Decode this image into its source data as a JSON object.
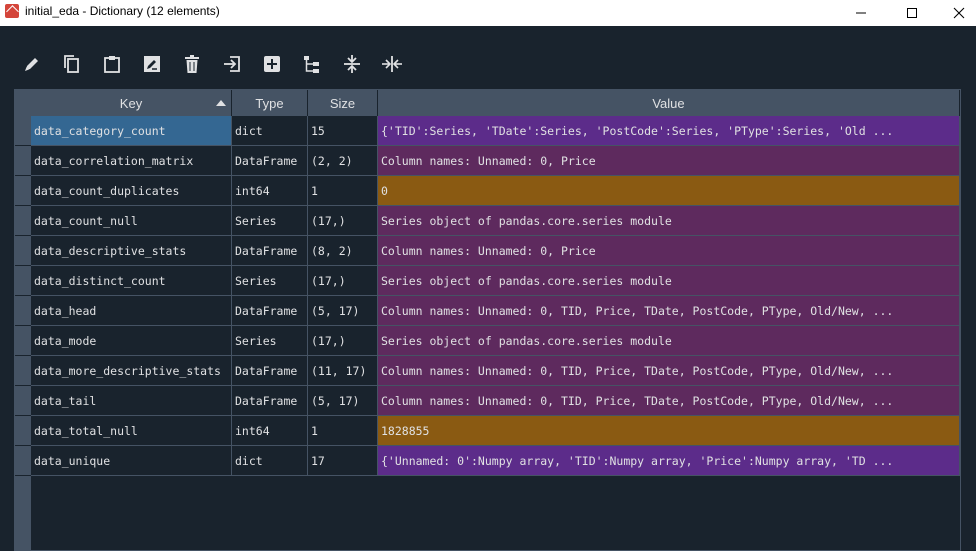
{
  "window": {
    "title": "initial_eda - Dictionary (12 elements)"
  },
  "toolbar": {
    "buttons": [
      "edit-icon",
      "copy-icon",
      "paste-icon",
      "rename-icon",
      "delete-icon",
      "insert-icon",
      "add-icon",
      "tree-icon",
      "collapse-icon",
      "resize-columns-icon"
    ]
  },
  "columns": {
    "key": "Key",
    "type": "Type",
    "size": "Size",
    "value": "Value"
  },
  "colors": {
    "dict": "#5c2c8a",
    "dataframe": "#5e2a5e",
    "series": "#5e2a5e",
    "int": "#8a5a12",
    "selected": "#346792"
  },
  "rows": [
    {
      "key": "data_category_count",
      "type": "dict",
      "size": "15",
      "value": "{'TID':Series, 'TDate':Series, 'PostCode':Series, 'PType':Series, 'Old ...",
      "color": "#5c2c8a"
    },
    {
      "key": "data_correlation_matrix",
      "type": "DataFrame",
      "size": "(2, 2)",
      "value": "Column names: Unnamed: 0, Price",
      "color": "#5e2a5e"
    },
    {
      "key": "data_count_duplicates",
      "type": "int64",
      "size": "1",
      "value": "0",
      "color": "#8a5a12"
    },
    {
      "key": "data_count_null",
      "type": "Series",
      "size": "(17,)",
      "value": "Series object of pandas.core.series module",
      "color": "#5e2a5e"
    },
    {
      "key": "data_descriptive_stats",
      "type": "DataFrame",
      "size": "(8, 2)",
      "value": "Column names: Unnamed: 0, Price",
      "color": "#5e2a5e"
    },
    {
      "key": "data_distinct_count",
      "type": "Series",
      "size": "(17,)",
      "value": "Series object of pandas.core.series module",
      "color": "#5e2a5e"
    },
    {
      "key": "data_head",
      "type": "DataFrame",
      "size": "(5, 17)",
      "value": "Column names: Unnamed: 0, TID, Price, TDate, PostCode, PType, Old/New, ...",
      "color": "#5e2a5e"
    },
    {
      "key": "data_mode",
      "type": "Series",
      "size": "(17,)",
      "value": "Series object of pandas.core.series module",
      "color": "#5e2a5e"
    },
    {
      "key": "data_more_descriptive_stats",
      "type": "DataFrame",
      "size": "(11, 17)",
      "value": "Column names: Unnamed: 0, TID, Price, TDate, PostCode, PType, Old/New, ...",
      "color": "#5e2a5e"
    },
    {
      "key": "data_tail",
      "type": "DataFrame",
      "size": "(5, 17)",
      "value": "Column names: Unnamed: 0, TID, Price, TDate, PostCode, PType, Old/New, ...",
      "color": "#5e2a5e"
    },
    {
      "key": "data_total_null",
      "type": "int64",
      "size": "1",
      "value": "1828855",
      "color": "#8a5a12"
    },
    {
      "key": "data_unique",
      "type": "dict",
      "size": "17",
      "value": "{'Unnamed: 0':Numpy array, 'TID':Numpy array, 'Price':Numpy array, 'TD ...",
      "color": "#5c2c8a"
    }
  ]
}
